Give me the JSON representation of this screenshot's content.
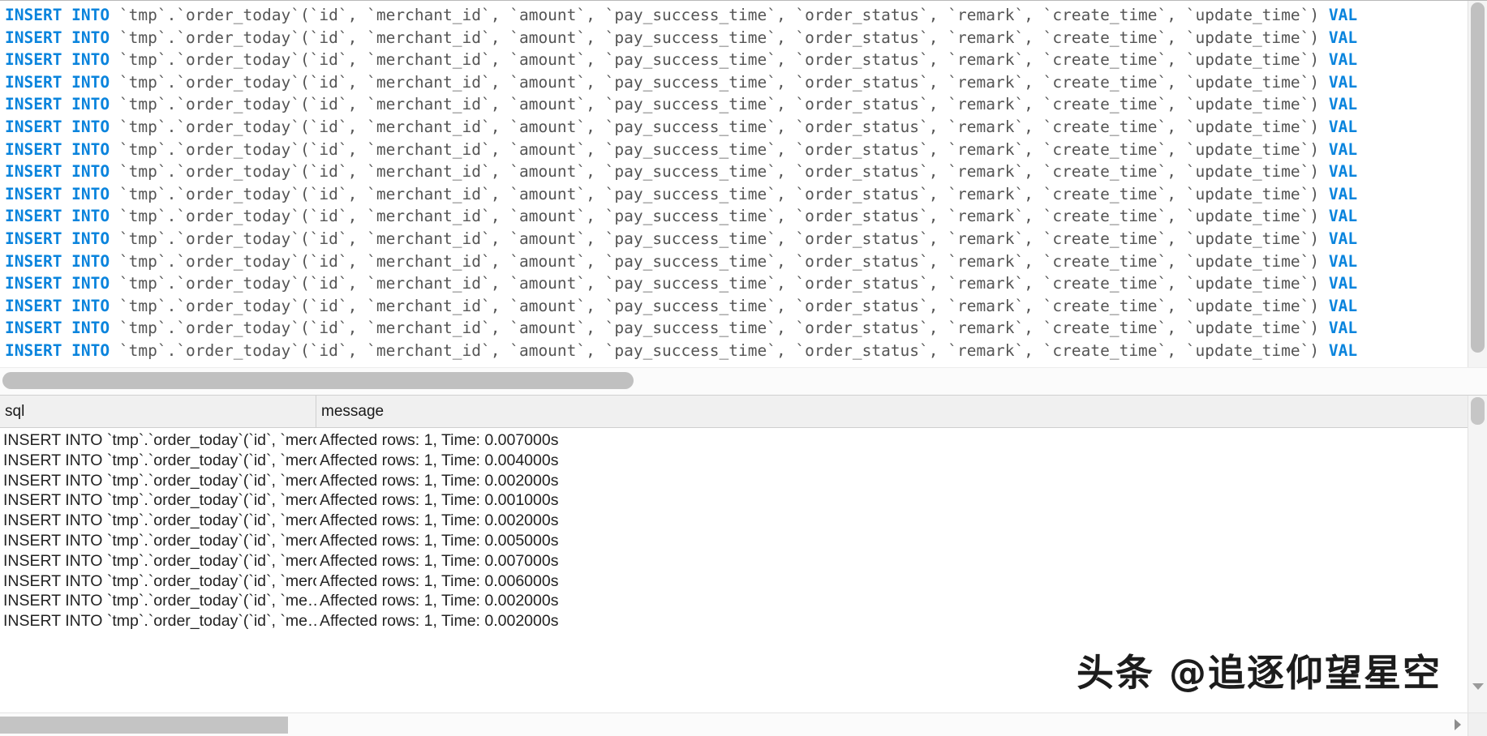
{
  "editor": {
    "keyword": "INSERT INTO",
    "statement_tail": " `tmp`.`order_today`(`id`, `merchant_id`, `amount`, `pay_success_time`, `order_status`, `remark`, `create_time`, `update_time`) ",
    "values_keyword": "VAL",
    "line_count": 15,
    "partial_last_line": true
  },
  "results": {
    "columns": [
      "sql",
      "message"
    ],
    "rows": [
      {
        "sql": "INSERT INTO `tmp`.`order_today`(`id`, `merch…",
        "message": "Affected rows: 1, Time: 0.007000s"
      },
      {
        "sql": "INSERT INTO `tmp`.`order_today`(`id`, `merch…",
        "message": "Affected rows: 1, Time: 0.004000s"
      },
      {
        "sql": "INSERT INTO `tmp`.`order_today`(`id`, `merch…",
        "message": "Affected rows: 1, Time: 0.002000s"
      },
      {
        "sql": "INSERT INTO `tmp`.`order_today`(`id`, `merch…",
        "message": "Affected rows: 1, Time: 0.001000s"
      },
      {
        "sql": "INSERT INTO `tmp`.`order_today`(`id`, `merch…",
        "message": "Affected rows: 1, Time: 0.002000s"
      },
      {
        "sql": "INSERT INTO `tmp`.`order_today`(`id`, `merch…",
        "message": "Affected rows: 1, Time: 0.005000s"
      },
      {
        "sql": "INSERT INTO `tmp`.`order_today`(`id`, `merch…",
        "message": "Affected rows: 1, Time: 0.007000s"
      },
      {
        "sql": "INSERT INTO `tmp`.`order_today`(`id`, `merch…",
        "message": "Affected rows: 1, Time: 0.006000s"
      },
      {
        "sql": "INSERT INTO `tmp`.`order_today`(`id`, `me…",
        "message": "Affected rows: 1, Time: 0.002000s"
      },
      {
        "sql": "INSERT INTO `tmp`.`order_today`(`id`, `me…",
        "message": "Affected rows: 1, Time: 0.002000s"
      }
    ]
  },
  "watermark": {
    "text": "头条 @追逐仰望星空"
  }
}
